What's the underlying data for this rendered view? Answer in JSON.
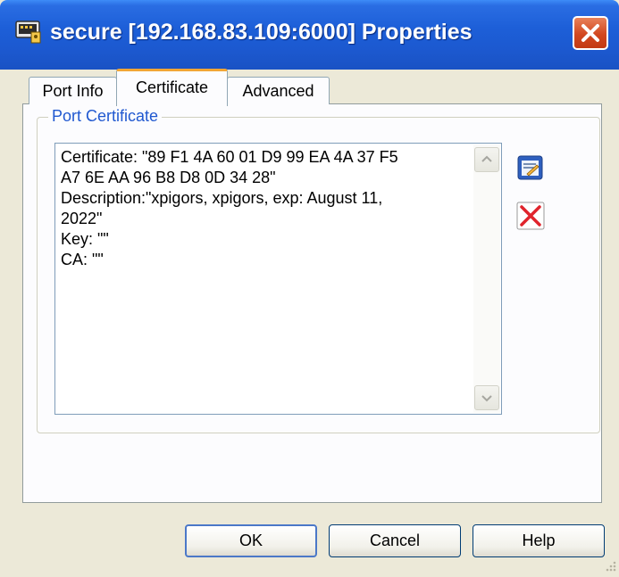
{
  "window": {
    "title": "secure [192.168.83.109:6000] Properties",
    "icon": "port-app-icon",
    "close_icon": "close-icon"
  },
  "tabs": [
    {
      "label": "Port Info",
      "selected": false
    },
    {
      "label": "Certificate",
      "selected": true
    },
    {
      "label": "Advanced",
      "selected": false
    }
  ],
  "certificate_panel": {
    "group_label": "Port Certificate",
    "text_lines": [
      "Certificate: \"89 F1 4A 60 01 D9 99 EA 4A 37 F5",
      "A7 6E AA 96 B8 D8 0D 34 28\"",
      "Description:\"xpigors, xpigors, exp: August 11,",
      "2022\"",
      "Key: \"\"",
      "CA: \"\""
    ],
    "edit_icon": "edit-icon",
    "delete_icon": "delete-icon"
  },
  "buttons": {
    "ok": "OK",
    "cancel": "Cancel",
    "help": "Help"
  },
  "colors": {
    "titlebar": "#1d5fd8",
    "accent_tab": "#f2a635",
    "group_label": "#2058d0",
    "delete_red": "#e0242c",
    "close_button": "#d2471f"
  }
}
